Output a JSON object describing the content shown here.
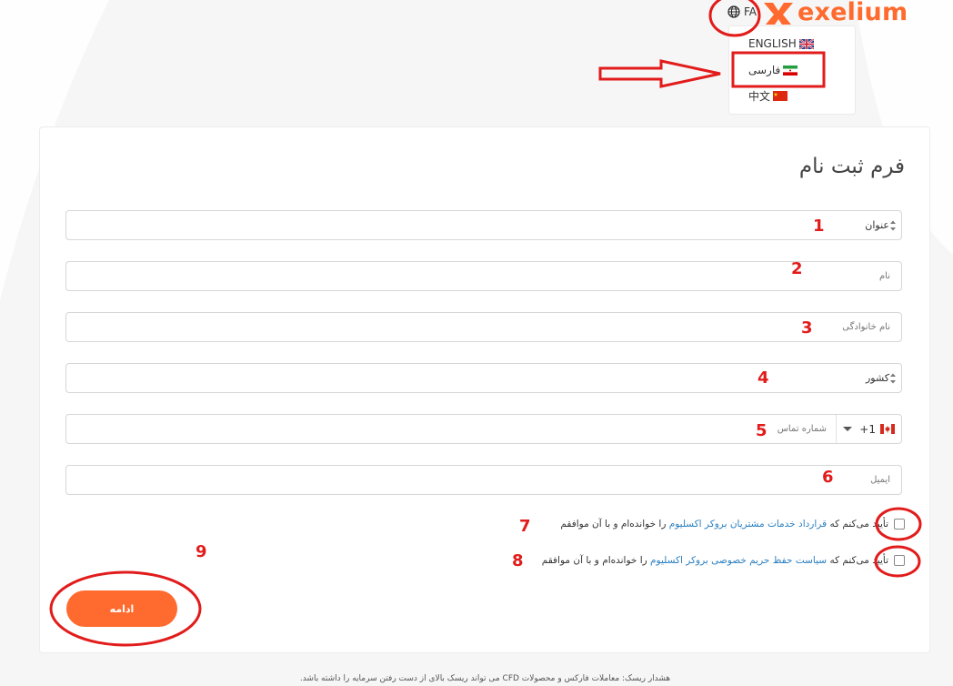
{
  "header": {
    "current_language": "FA",
    "logo_text": "exelium",
    "language_menu": [
      {
        "label": "ENGLISH",
        "flag": "uk-flag"
      },
      {
        "label": "فارسی",
        "flag": "iran-flag"
      },
      {
        "label": "中文",
        "flag": "china-flag"
      }
    ]
  },
  "form": {
    "title": "فرم ثبت نام",
    "fields": {
      "title_select": "عنوان",
      "first_name": "نام",
      "last_name": "نام خانوادگی",
      "country_select": "کشور",
      "phone_code": "+1",
      "phone_placeholder": "شماره تماس",
      "email": "ایمیل"
    },
    "consent1": {
      "prefix": "تأیید می‌کنم که",
      "link": "قرارداد خدمات مشتریان بروکر اکسلیوم",
      "suffix": "را خوانده‌ام و با آن موافقم"
    },
    "consent2": {
      "prefix": "تأیید می‌کنم که",
      "link": "سیاست حفظ حریم خصوصی بروکر اکسلیوم",
      "suffix": "را خوانده‌ام و با آن موافقم"
    },
    "submit_label": "ادامه"
  },
  "disclaimer": "هشدار ریسک: معاملات فارکس و محصولات CFD می تواند ریسک بالای از دست رفتن سرمایه را داشته باشد.",
  "annotations": [
    "1",
    "2",
    "3",
    "4",
    "5",
    "6",
    "7",
    "8",
    "9"
  ],
  "colors": {
    "accent": "#ff6a2e",
    "annotation": "#e21b1b",
    "link": "#2a7fc0"
  }
}
